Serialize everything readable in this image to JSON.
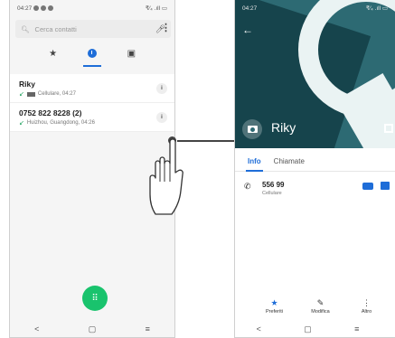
{
  "left_phone": {
    "status": {
      "time": "04:27",
      "right": "₹⁄₄ .ıll ▭"
    },
    "search": {
      "placeholder": "Cerca contatti"
    },
    "tabs": [
      {
        "name": "favorites",
        "glyph": "★"
      },
      {
        "name": "recents",
        "glyph": ""
      },
      {
        "name": "contacts",
        "glyph": "▣"
      }
    ],
    "calls": [
      {
        "name": "Riky",
        "detail": "Cellulare, 04:27"
      },
      {
        "name": "0752 822 8228 (2)",
        "detail": "Huizhou, Guangdong, 04:26"
      }
    ],
    "fab_glyph": "⠿",
    "nav": [
      "<",
      "▢",
      "≡"
    ]
  },
  "right_phone": {
    "status": {
      "time": "04:27",
      "right": "₹⁄₄ .ıll ▭"
    },
    "contact_name": "Riky",
    "tabs": [
      "Info",
      "Chiamate"
    ],
    "phone": {
      "number": "556 99",
      "label": "Cellulare"
    },
    "actions": [
      {
        "label": "Preferiti",
        "glyph": "★"
      },
      {
        "label": "Modifica",
        "glyph": "✎"
      },
      {
        "label": "Altro",
        "glyph": "⋮"
      }
    ],
    "nav": [
      "<",
      "▢",
      "≡"
    ]
  },
  "colors": {
    "accent": "#1e6dd8",
    "fab": "#19c36d",
    "hero": "#2d6a73"
  }
}
